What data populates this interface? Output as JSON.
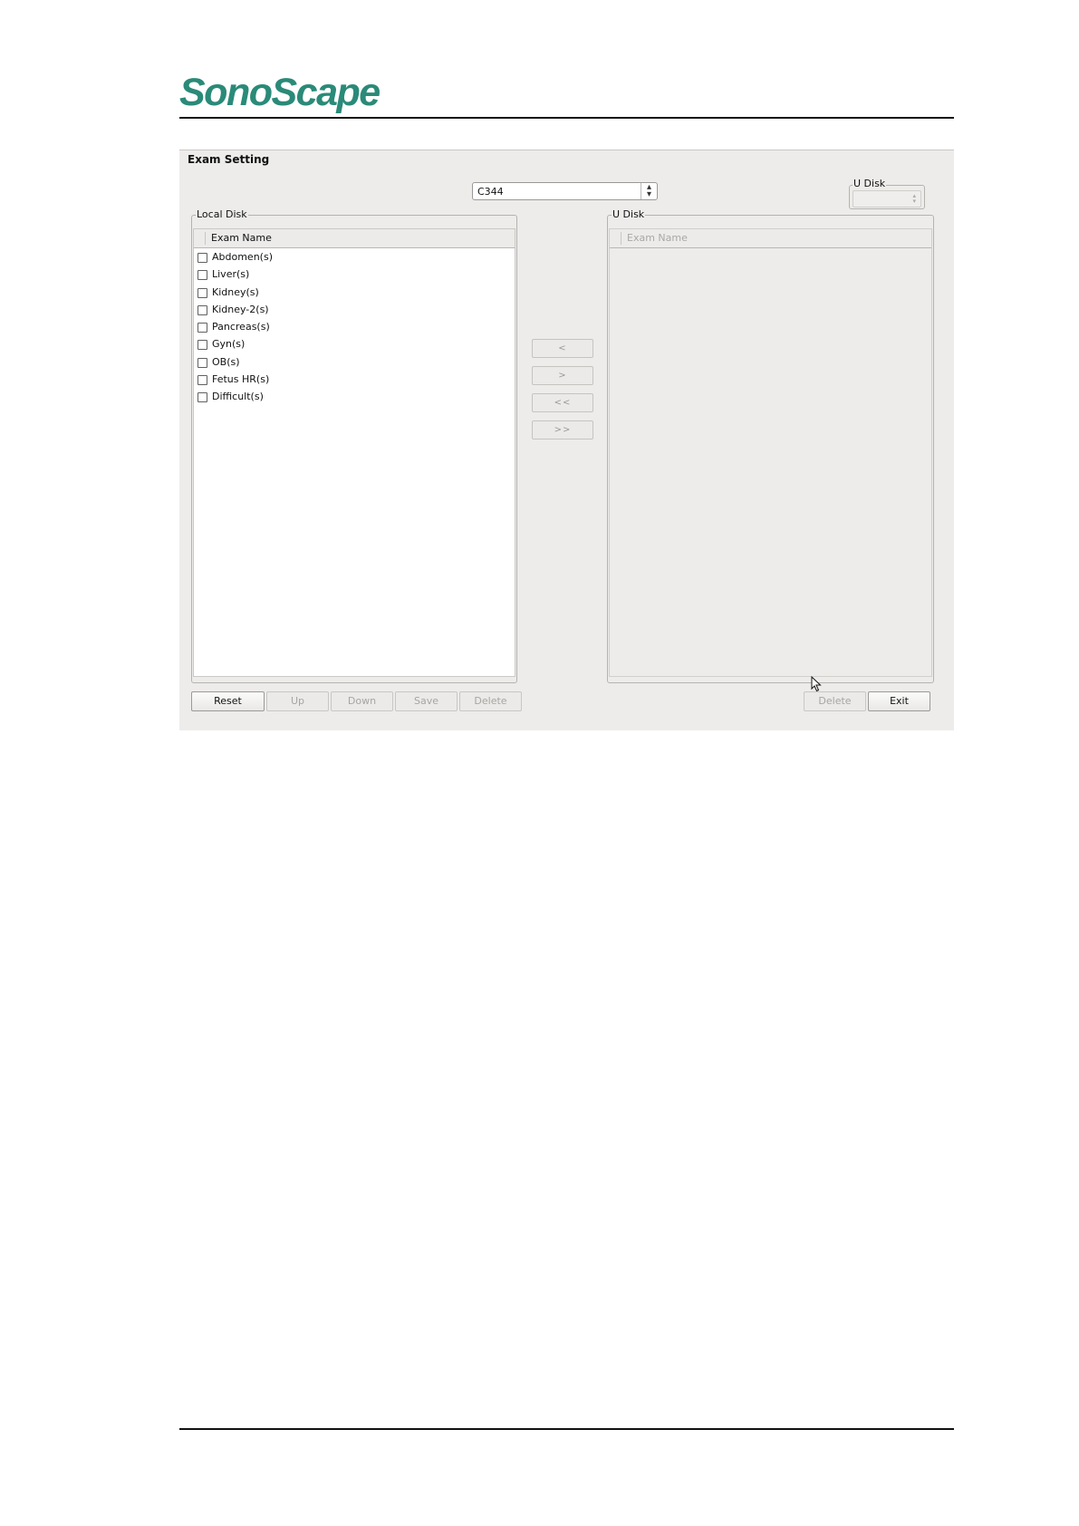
{
  "logo": {
    "text": "SonoScape",
    "color": "#2a8a78"
  },
  "dialog": {
    "title": "Exam Setting",
    "probe_select": {
      "value": "C344"
    },
    "udisk_group": {
      "label": "U Disk",
      "value": ""
    },
    "local_disk": {
      "label": "Local Disk",
      "column_header": "Exam Name",
      "items": [
        {
          "label": "Abdomen(s)",
          "checked": false
        },
        {
          "label": "Liver(s)",
          "checked": false
        },
        {
          "label": "Kidney(s)",
          "checked": false
        },
        {
          "label": "Kidney-2(s)",
          "checked": false
        },
        {
          "label": "Pancreas(s)",
          "checked": false
        },
        {
          "label": "Gyn(s)",
          "checked": false
        },
        {
          "label": "OB(s)",
          "checked": false
        },
        {
          "label": "Fetus HR(s)",
          "checked": false
        },
        {
          "label": "Difficult(s)",
          "checked": false
        }
      ]
    },
    "u_disk": {
      "label": "U Disk",
      "column_header": "Exam Name",
      "items": []
    },
    "transfer_buttons": {
      "copy_left": "<",
      "copy_right": ">",
      "copy_all_left": "<<",
      "copy_all_right": ">>"
    },
    "buttons": {
      "reset": "Reset",
      "up": "Up",
      "down": "Down",
      "save": "Save",
      "delete_local": "Delete",
      "delete_udisk": "Delete",
      "exit": "Exit"
    }
  }
}
